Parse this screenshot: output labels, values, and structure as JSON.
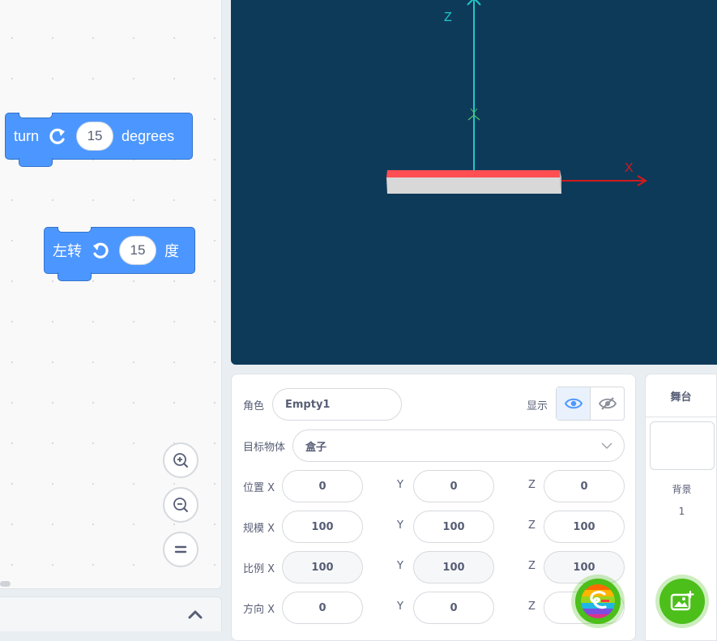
{
  "blocks": {
    "turn_right": {
      "label": "turn",
      "value": "15",
      "suffix": "degrees"
    },
    "turn_left": {
      "label": "左转",
      "value": "15",
      "suffix": "度"
    }
  },
  "stage": {
    "axis_z_label": "Z",
    "axis_x_label": "X",
    "background_color": "#0e3a5a",
    "axis_z_color": "#1ec9c9",
    "axis_x_color": "#d11b1b",
    "box_top_color": "#ff4f52",
    "box_side_color": "#d8d8d8"
  },
  "sprite": {
    "name_label": "角色",
    "name_value": "Empty1",
    "show_label": "显示",
    "target_label": "目标物体",
    "target_value": "盒子",
    "position": {
      "label": "位置 X",
      "x": "0",
      "y_label": "Y",
      "y": "0",
      "z_label": "Z",
      "z": "0"
    },
    "size": {
      "label": "规模 X",
      "x": "100",
      "y_label": "Y",
      "y": "100",
      "z_label": "Z",
      "z": "100"
    },
    "scale": {
      "label": "比例 X",
      "x": "100",
      "y_label": "Y",
      "y": "100",
      "z_label": "Z",
      "z": "100"
    },
    "direction": {
      "label": "方向 X",
      "x": "0",
      "y_label": "Y",
      "y": "0",
      "z_label": "Z",
      "z": ""
    }
  },
  "stage_panel": {
    "title": "舞台",
    "backdrop_label": "背景",
    "backdrop_count": "1"
  },
  "icons": {
    "zoom_in": "zoom-in-icon",
    "zoom_out": "zoom-out-icon",
    "zoom_reset": "zoom-reset-icon",
    "eye": "eye-icon",
    "eye_off": "eye-off-icon",
    "sprite_library": "sprite-library-icon",
    "add_backdrop": "add-backdrop-icon",
    "collapse": "chevron-up-icon"
  },
  "colors": {
    "block": "#4c97ff",
    "accent_green": "#4cbf1a",
    "eye_active": "#4c97ff"
  }
}
